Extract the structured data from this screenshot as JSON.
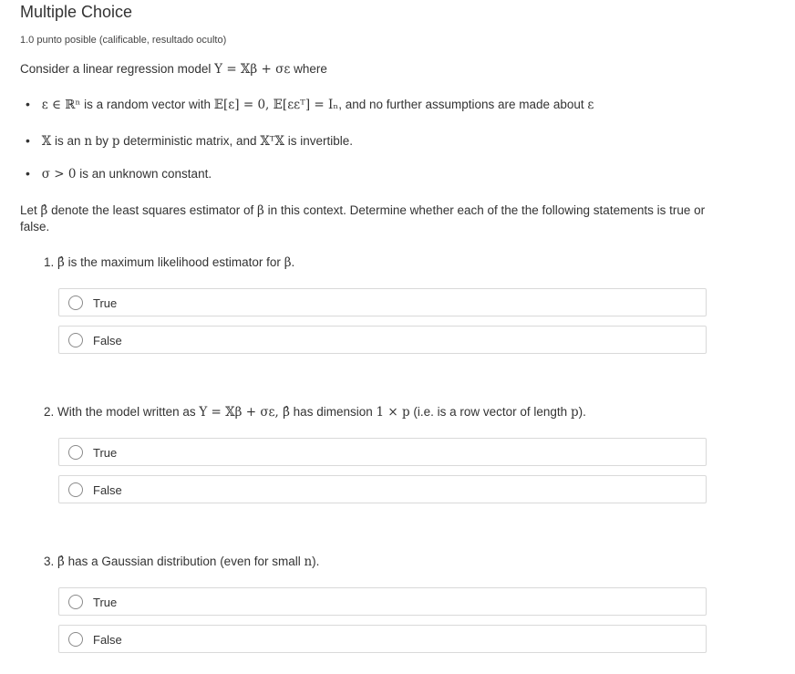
{
  "header": {
    "title": "Multiple Choice",
    "points": "1.0 punto posible (calificable, resultado oculto)"
  },
  "problem": {
    "intro_prefix": "Consider a linear regression model",
    "intro_model": "Y = 𝕏β + σε",
    "intro_suffix": "where",
    "bullets": [
      {
        "math1": "ε ∈ ℝⁿ",
        "text1": "is a random vector with",
        "math2": "𝔼[ε] = 0, 𝔼[εεᵀ] = Iₙ",
        "text2": ", and no further assumptions are made about",
        "math3": "ε"
      },
      {
        "math1": "𝕏",
        "text1": "is an",
        "math2": "n",
        "text2": "by",
        "math3": "p",
        "text3": "deterministic matrix, and",
        "math4": "𝕏ᵀ𝕏",
        "text4": "is invertible."
      },
      {
        "math1": "σ > 0",
        "text1": "is an unknown constant."
      }
    ],
    "paragraph_prefix": "Let",
    "paragraph_symbol": "β̂",
    "paragraph_mid": "denote the least squares estimator of",
    "paragraph_symbol2": "β",
    "paragraph_suffix": "in this context. Determine whether each of the the following statements is true or false."
  },
  "questions": [
    {
      "number": "1.",
      "parts": [
        "β̂",
        " is the maximum likelihood estimator for ",
        "β",
        "."
      ],
      "options": [
        "True",
        "False"
      ]
    },
    {
      "number": "2.",
      "parts": [
        "With the model written as ",
        "Y = 𝕏β + σε, β̂",
        " has dimension ",
        "1 × p",
        " (i.e. is a row vector of length ",
        "p",
        ")."
      ],
      "options": [
        "True",
        "False"
      ]
    },
    {
      "number": "3.",
      "parts": [
        "β̂",
        " has a Gaussian distribution (even for small ",
        "n",
        ")."
      ],
      "options": [
        "True",
        "False"
      ]
    }
  ]
}
